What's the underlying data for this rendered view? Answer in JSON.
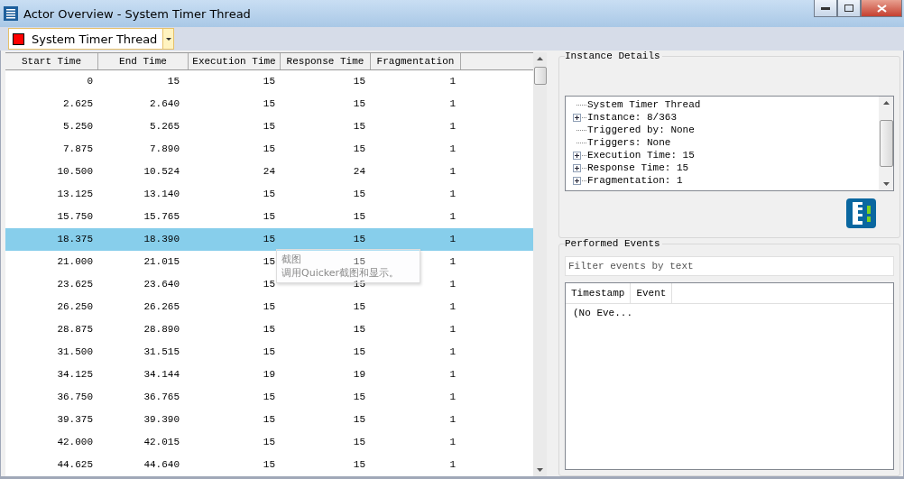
{
  "window": {
    "title": "Actor Overview - System Timer Thread"
  },
  "actor_selector": {
    "value": "System Timer Thread",
    "color": "#ff0000"
  },
  "table": {
    "columns": [
      "Start Time",
      "End Time",
      "Execution Time",
      "Response Time",
      "Fragmentation"
    ],
    "rows": [
      {
        "cells": [
          "0",
          "15",
          "15",
          "15",
          "1"
        ],
        "selected": false
      },
      {
        "cells": [
          "2.625",
          "2.640",
          "15",
          "15",
          "1"
        ],
        "selected": false
      },
      {
        "cells": [
          "5.250",
          "5.265",
          "15",
          "15",
          "1"
        ],
        "selected": false
      },
      {
        "cells": [
          "7.875",
          "7.890",
          "15",
          "15",
          "1"
        ],
        "selected": false
      },
      {
        "cells": [
          "10.500",
          "10.524",
          "24",
          "24",
          "1"
        ],
        "selected": false
      },
      {
        "cells": [
          "13.125",
          "13.140",
          "15",
          "15",
          "1"
        ],
        "selected": false
      },
      {
        "cells": [
          "15.750",
          "15.765",
          "15",
          "15",
          "1"
        ],
        "selected": false
      },
      {
        "cells": [
          "18.375",
          "18.390",
          "15",
          "15",
          "1"
        ],
        "selected": true
      },
      {
        "cells": [
          "21.000",
          "21.015",
          "15",
          "15",
          "1"
        ],
        "selected": false
      },
      {
        "cells": [
          "23.625",
          "23.640",
          "15",
          "15",
          "1"
        ],
        "selected": false
      },
      {
        "cells": [
          "26.250",
          "26.265",
          "15",
          "15",
          "1"
        ],
        "selected": false
      },
      {
        "cells": [
          "28.875",
          "28.890",
          "15",
          "15",
          "1"
        ],
        "selected": false
      },
      {
        "cells": [
          "31.500",
          "31.515",
          "15",
          "15",
          "1"
        ],
        "selected": false
      },
      {
        "cells": [
          "34.125",
          "34.144",
          "19",
          "19",
          "1"
        ],
        "selected": false
      },
      {
        "cells": [
          "36.750",
          "36.765",
          "15",
          "15",
          "1"
        ],
        "selected": false
      },
      {
        "cells": [
          "39.375",
          "39.390",
          "15",
          "15",
          "1"
        ],
        "selected": false
      },
      {
        "cells": [
          "42.000",
          "42.015",
          "15",
          "15",
          "1"
        ],
        "selected": false
      },
      {
        "cells": [
          "44.625",
          "44.640",
          "15",
          "15",
          "1"
        ],
        "selected": false
      }
    ]
  },
  "tooltip": {
    "title": "截图",
    "text": "调用Quicker截图和显示。"
  },
  "instance_details": {
    "title": "Instance Details",
    "tree": [
      {
        "label": "System Timer Thread",
        "expandable": false
      },
      {
        "label": "Instance: 8/363",
        "expandable": true
      },
      {
        "label": "Triggered by: None",
        "expandable": false
      },
      {
        "label": "Triggers: None",
        "expandable": false
      },
      {
        "label": "Execution Time: 15",
        "expandable": true
      },
      {
        "label": "Response Time: 15",
        "expandable": true
      },
      {
        "label": "Fragmentation: 1",
        "expandable": true
      }
    ]
  },
  "performed_events": {
    "title": "Performed Events",
    "filter": {
      "placeholder": "Filter events by text"
    },
    "columns": [
      "Timestamp",
      "Event"
    ],
    "empty_text": "(No Eve..."
  }
}
